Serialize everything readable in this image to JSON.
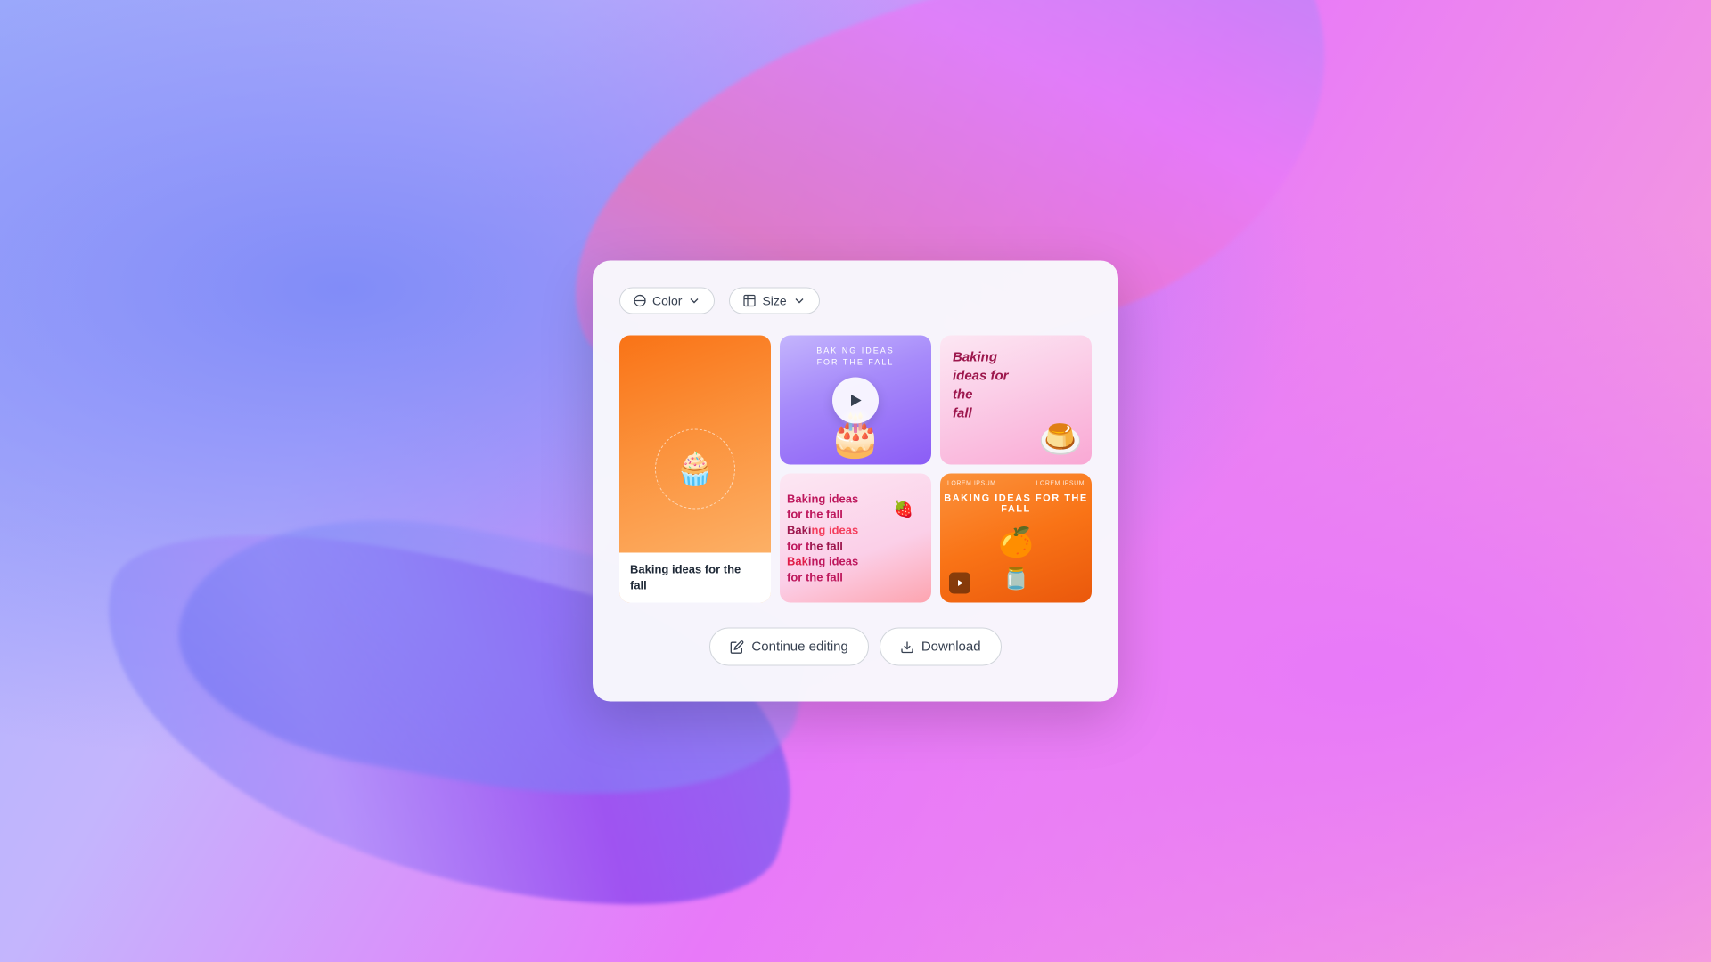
{
  "background": {
    "gradient_start": "#a78bfa",
    "gradient_end": "#f472b6"
  },
  "modal": {
    "toolbar": {
      "color_label": "Color",
      "size_label": "Size"
    },
    "cards": [
      {
        "id": 1,
        "type": "tall",
        "theme": "orange_gradient",
        "has_video_icon": true,
        "bottom_text": "Baking ideas for the fall"
      },
      {
        "id": 2,
        "type": "square",
        "theme": "purple",
        "title": "BAKING IDEAS",
        "subtitle": "FOR THE FALL",
        "has_play_overlay": true
      },
      {
        "id": 3,
        "type": "square",
        "theme": "pink",
        "text": "Baking\nideas for\nthe\nfall"
      },
      {
        "id": 4,
        "type": "square",
        "theme": "light_pink",
        "text": "Baking ideas\nfor the fall\nBaking ideas\nfor the fall\nBaking ideas\nfor the fall"
      },
      {
        "id": 5,
        "type": "square",
        "theme": "orange",
        "label_left": "LOREM IPSUM",
        "label_right": "LOREM IPSUM",
        "title": "BAKING IDEAS FOR THE FALL",
        "has_video_icon": true
      }
    ],
    "actions": {
      "continue_label": "Continue editing",
      "download_label": "Download"
    }
  }
}
